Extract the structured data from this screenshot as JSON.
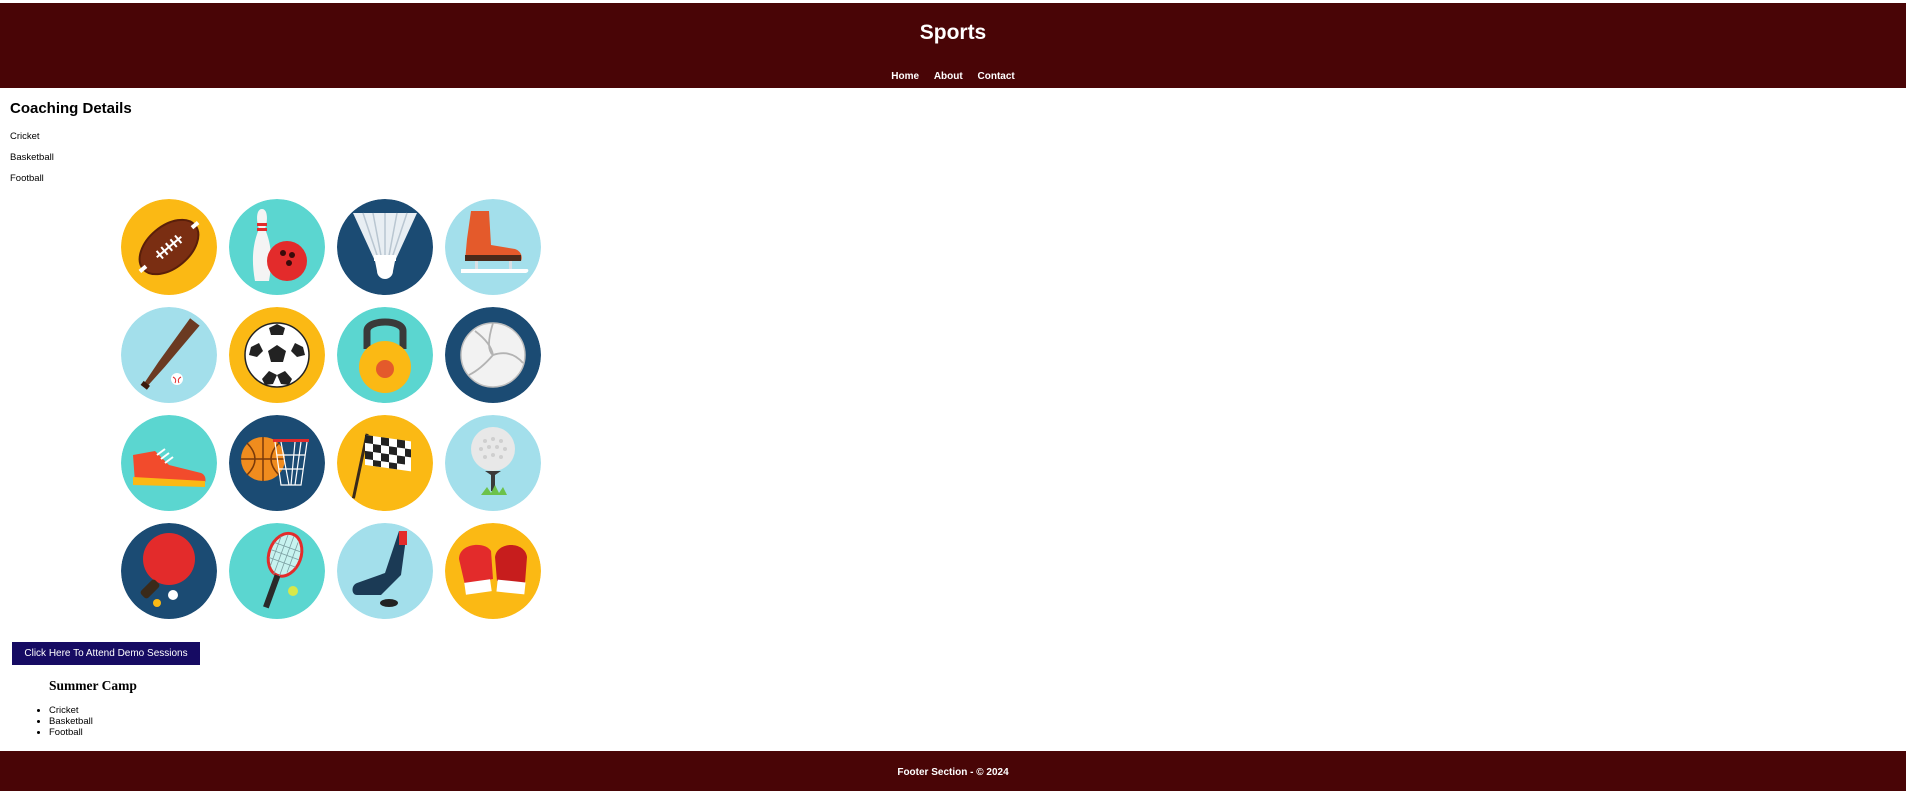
{
  "header": {
    "title": "Sports",
    "nav": [
      "Home",
      "About",
      "Contact"
    ]
  },
  "coaching": {
    "title": "Coaching Details",
    "items": [
      "Cricket",
      "Basketball",
      "Football"
    ]
  },
  "sports_icons": [
    {
      "name": "american-football-icon",
      "bg": "#fbb914"
    },
    {
      "name": "bowling-icon",
      "bg": "#5bd6d0"
    },
    {
      "name": "shuttlecock-icon",
      "bg": "#1b4b73"
    },
    {
      "name": "ice-skate-icon",
      "bg": "#a3dfeb"
    },
    {
      "name": "baseball-bat-icon",
      "bg": "#a3dfeb"
    },
    {
      "name": "soccer-ball-icon",
      "bg": "#fbb914"
    },
    {
      "name": "kettlebell-icon",
      "bg": "#5bd6d0"
    },
    {
      "name": "volleyball-icon",
      "bg": "#1b4b73"
    },
    {
      "name": "sneaker-icon",
      "bg": "#5bd6d0"
    },
    {
      "name": "basketball-hoop-icon",
      "bg": "#1b4b73"
    },
    {
      "name": "checkered-flag-icon",
      "bg": "#fbb914"
    },
    {
      "name": "golf-ball-icon",
      "bg": "#a3dfeb"
    },
    {
      "name": "ping-pong-icon",
      "bg": "#1b4b73"
    },
    {
      "name": "tennis-racket-icon",
      "bg": "#5bd6d0"
    },
    {
      "name": "hockey-stick-icon",
      "bg": "#a3dfeb"
    },
    {
      "name": "boxing-gloves-icon",
      "bg": "#fbb914"
    }
  ],
  "demo_button": {
    "label": "Click Here To Attend Demo Sessions"
  },
  "camp": {
    "title": "Summer Camp",
    "items": [
      "Cricket",
      "Basketball",
      "Football"
    ]
  },
  "footer": {
    "text": "Footer Section - © 2024"
  },
  "colors": {
    "header_bg": "#490506",
    "footer_bg": "#490506",
    "button_bg": "#160b63"
  }
}
